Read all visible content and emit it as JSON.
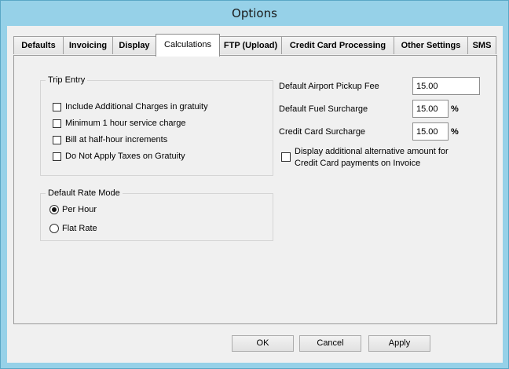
{
  "window": {
    "title": "Options"
  },
  "tabs": [
    {
      "label": "Defaults"
    },
    {
      "label": "Invoicing"
    },
    {
      "label": "Display"
    },
    {
      "label": "Calculations"
    },
    {
      "label": "FTP (Upload)"
    },
    {
      "label": "Credit Card Processing"
    },
    {
      "label": "Other Settings"
    },
    {
      "label": "SMS"
    }
  ],
  "active_tab": "Calculations",
  "trip_entry": {
    "title": "Trip Entry",
    "options": [
      {
        "label": "Include Additional Charges in gratuity",
        "checked": false
      },
      {
        "label": "Minimum 1 hour service charge",
        "checked": false
      },
      {
        "label": "Bill at half-hour increments",
        "checked": false
      },
      {
        "label": "Do Not Apply Taxes on Gratuity",
        "checked": false
      }
    ]
  },
  "rate_mode": {
    "title": "Default Rate Mode",
    "options": [
      {
        "label": "Per Hour",
        "selected": true
      },
      {
        "label": "Flat Rate",
        "selected": false
      }
    ]
  },
  "fees": {
    "airport_pickup": {
      "label": "Default Airport Pickup Fee",
      "value": "15.00"
    },
    "fuel_surcharge": {
      "label": "Default Fuel Surcharge",
      "value": "15.00",
      "unit": "%"
    },
    "credit_card_surcharge": {
      "label": "Credit Card Surcharge",
      "value": "15.00",
      "unit": "%"
    }
  },
  "alt_amount": {
    "line1": "Display additional alternative amount for",
    "line2": "Credit Card payments on Invoice",
    "checked": false
  },
  "buttons": {
    "ok": "OK",
    "cancel": "Cancel",
    "apply": "Apply"
  }
}
